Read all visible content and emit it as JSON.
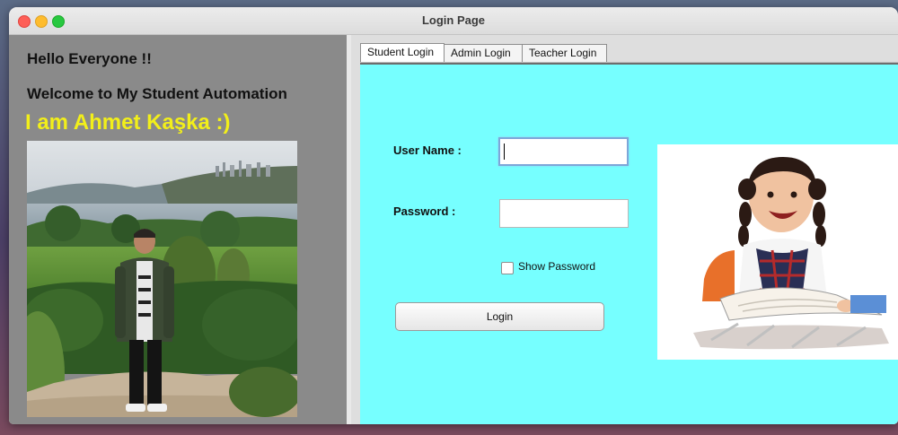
{
  "window": {
    "title": "Login Page"
  },
  "left": {
    "greeting_1": "Hello Everyone !!",
    "greeting_2": "Welcome to My Student Automation",
    "greeting_3": "I am Ahmet Kaşka :)"
  },
  "tabs": [
    {
      "label": "Student Login",
      "active": true
    },
    {
      "label": "Admin Login",
      "active": false
    },
    {
      "label": "Teacher Login",
      "active": false
    }
  ],
  "form": {
    "username_label": "User Name :",
    "username_value": "",
    "password_label": "Password  :",
    "password_value": "",
    "show_password_label": "Show Password",
    "show_password_checked": false,
    "login_button": "Login"
  },
  "colors": {
    "left_panel_bg": "#8a8a8a",
    "accent_yellow": "#f2ef1a",
    "content_bg": "#76ffff"
  }
}
